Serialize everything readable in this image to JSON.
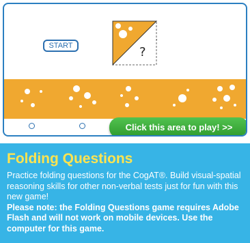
{
  "preview": {
    "start_label": "START",
    "question_mark": "?",
    "play_button": "Click this area to play! >>",
    "choices": 5,
    "colors": {
      "border": "#2b7fc1",
      "cheese": "#f0a830",
      "play_green": "#3eab3c"
    }
  },
  "info": {
    "title": "Folding Questions",
    "description": "Practice folding questions for the CogAT®. Build visual-spatial reasoning skills for other non-verbal tests just for fun with this new game!",
    "note": "Please note: the Folding Questions game requires Adobe Flash and will not work on mobile devices. Use the computer for this game.",
    "colors": {
      "background": "#37b4e6",
      "title": "#ffe44f"
    }
  }
}
